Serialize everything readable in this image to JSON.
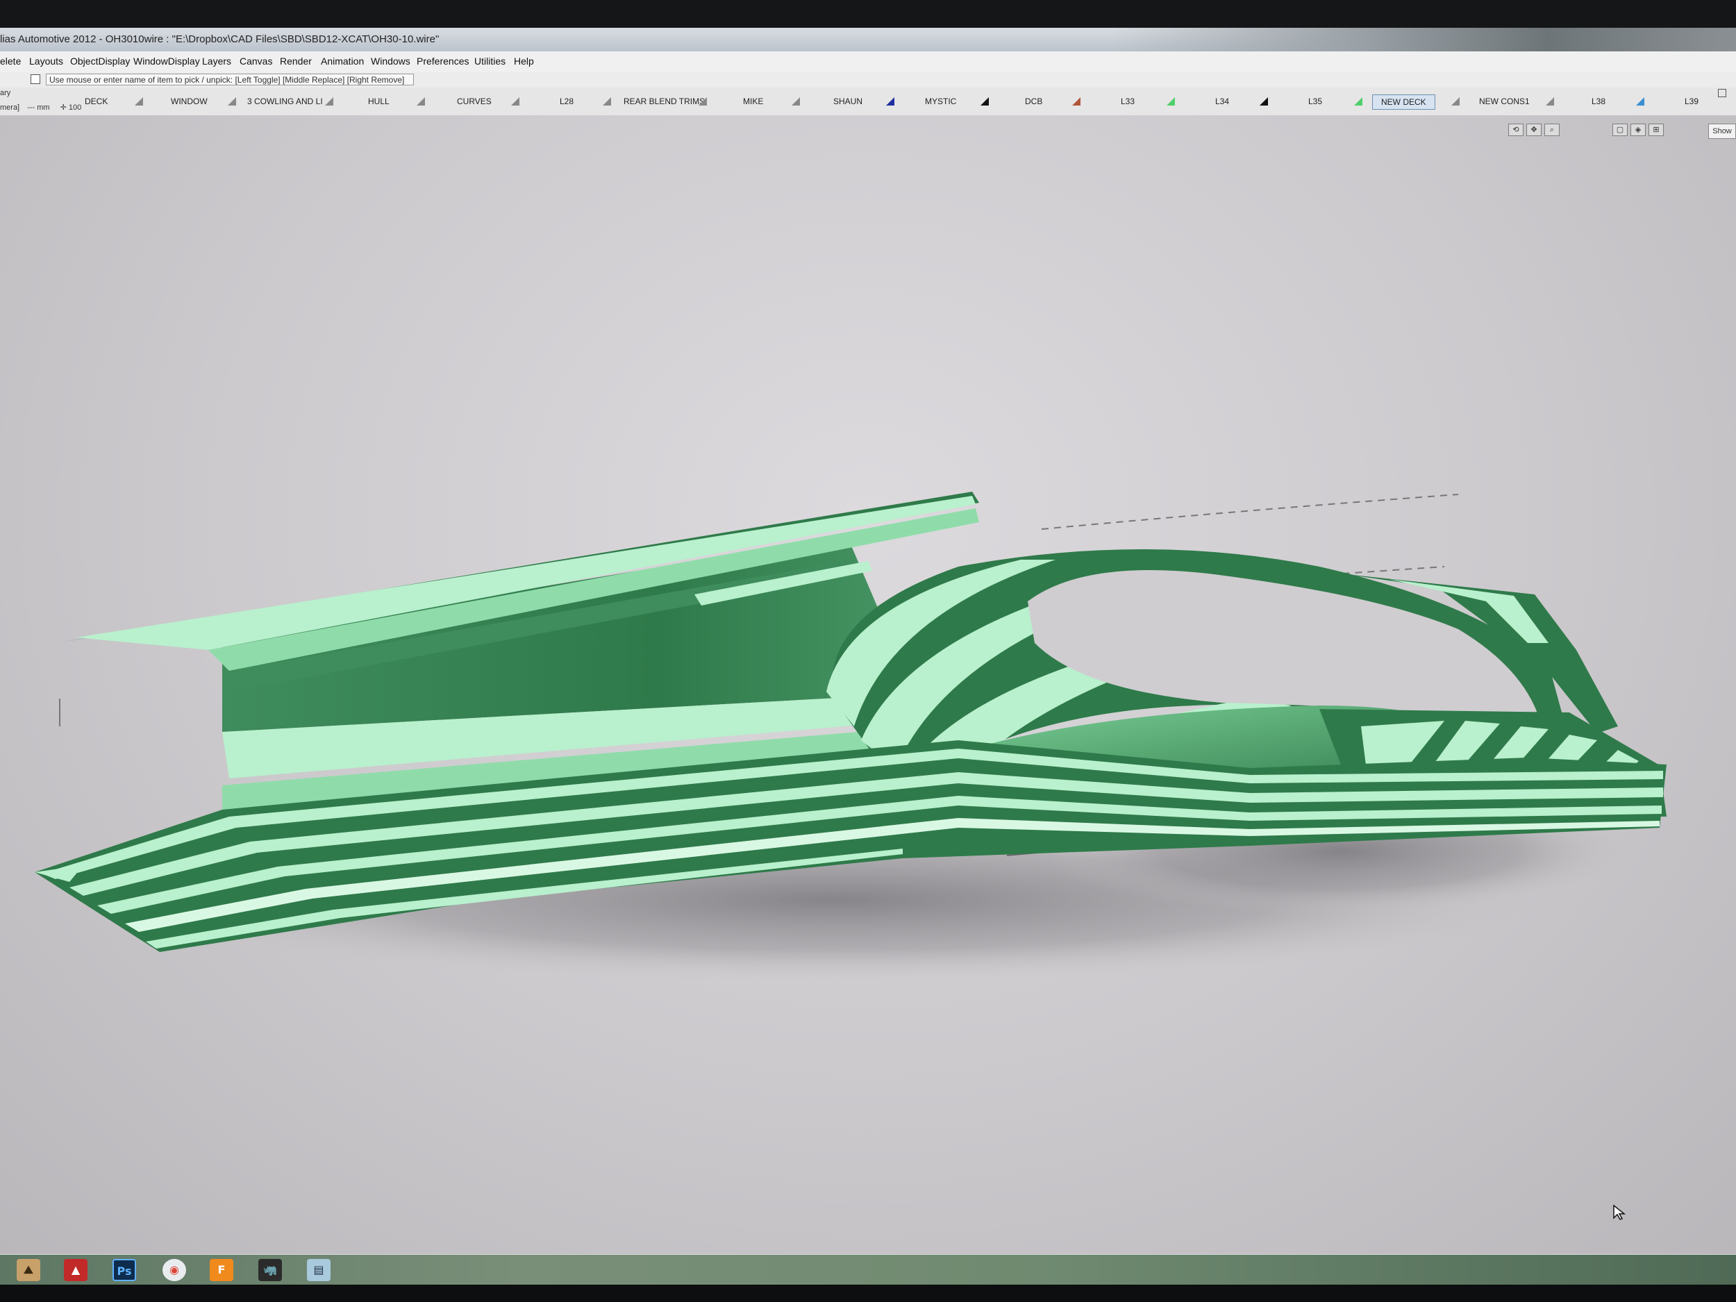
{
  "window": {
    "title": "lias Automotive 2012 - OH3010wire : \"E:\\Dropbox\\CAD Files\\SBD\\SBD12-XCAT\\OH30-10.wire\""
  },
  "menubar": {
    "items": [
      "elete",
      "Layouts",
      "ObjectDisplay",
      "WindowDisplay",
      "Layers",
      "Canvas",
      "Render",
      "Animation",
      "Windows",
      "Preferences",
      "Utilities",
      "Help"
    ]
  },
  "promptbar": {
    "message": "Use mouse or enter name of item to pick / unpick: [Left Toggle] [Middle Replace] [Right Remove]"
  },
  "layerbar": {
    "left_top": "ary",
    "left_bottom": "mera]",
    "units": "--- mm",
    "zoom": "100",
    "layers": [
      {
        "label": "DECK",
        "color": "#888888"
      },
      {
        "label": "WINDOW",
        "color": "#888888"
      },
      {
        "label": "3 COWLING AND LI",
        "color": "#888888"
      },
      {
        "label": "HULL",
        "color": "#888888"
      },
      {
        "label": "CURVES",
        "color": "#888888"
      },
      {
        "label": "L28",
        "color": "#888888"
      },
      {
        "label": "REAR BLEND TRIMS",
        "color": "#888888"
      },
      {
        "label": "MIKE",
        "color": "#888888"
      },
      {
        "label": "SHAUN",
        "color": "#1f2fa0"
      },
      {
        "label": "MYSTIC",
        "color": "#111111"
      },
      {
        "label": "DCB",
        "color": "#b0563a"
      },
      {
        "label": "L33",
        "color": "#4fcf6a"
      },
      {
        "label": "L34",
        "color": "#111111"
      },
      {
        "label": "L35",
        "color": "#4fcf6a"
      },
      {
        "label": "NEW DECK",
        "color": "#888888",
        "active": true
      },
      {
        "label": "NEW CONS1",
        "color": "#888888"
      },
      {
        "label": "L38",
        "color": "#3a8fd0"
      },
      {
        "label": "L39",
        "color": "#888888"
      }
    ]
  },
  "viewport": {
    "show_label": "Show",
    "model_color_dark": "#2f7a4a",
    "model_color_light": "#b9f0cd",
    "model_color_mid": "#5fae7a",
    "background": "#cbc9cc"
  },
  "taskbar": {
    "apps": [
      {
        "name": "alias-icon",
        "glyph": "⛰"
      },
      {
        "name": "autodesk-icon",
        "glyph": "▲"
      },
      {
        "name": "photoshop-icon",
        "glyph": "Ps"
      },
      {
        "name": "chrome-icon",
        "glyph": "◉"
      },
      {
        "name": "fusion-icon",
        "glyph": "F"
      },
      {
        "name": "rhino-icon",
        "glyph": "🦏"
      },
      {
        "name": "notepad-icon",
        "glyph": "▤"
      }
    ]
  }
}
